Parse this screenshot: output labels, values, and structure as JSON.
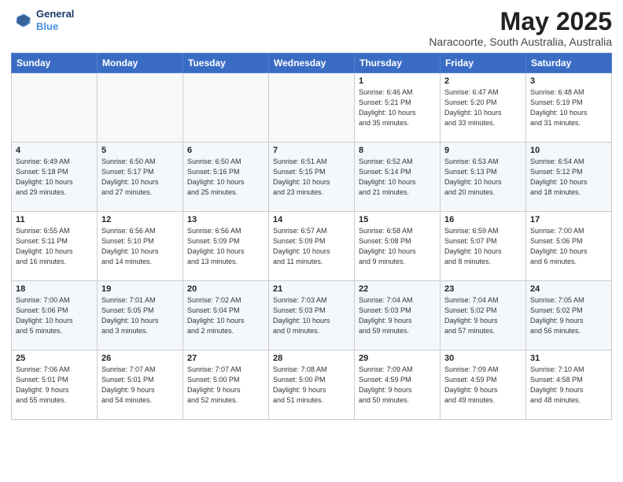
{
  "header": {
    "logo_line1": "General",
    "logo_line2": "Blue",
    "month_title": "May 2025",
    "subtitle": "Naracoorte, South Australia, Australia"
  },
  "days_of_week": [
    "Sunday",
    "Monday",
    "Tuesday",
    "Wednesday",
    "Thursday",
    "Friday",
    "Saturday"
  ],
  "weeks": [
    [
      {
        "day": "",
        "info": ""
      },
      {
        "day": "",
        "info": ""
      },
      {
        "day": "",
        "info": ""
      },
      {
        "day": "",
        "info": ""
      },
      {
        "day": "1",
        "info": "Sunrise: 6:46 AM\nSunset: 5:21 PM\nDaylight: 10 hours\nand 35 minutes."
      },
      {
        "day": "2",
        "info": "Sunrise: 6:47 AM\nSunset: 5:20 PM\nDaylight: 10 hours\nand 33 minutes."
      },
      {
        "day": "3",
        "info": "Sunrise: 6:48 AM\nSunset: 5:19 PM\nDaylight: 10 hours\nand 31 minutes."
      }
    ],
    [
      {
        "day": "4",
        "info": "Sunrise: 6:49 AM\nSunset: 5:18 PM\nDaylight: 10 hours\nand 29 minutes."
      },
      {
        "day": "5",
        "info": "Sunrise: 6:50 AM\nSunset: 5:17 PM\nDaylight: 10 hours\nand 27 minutes."
      },
      {
        "day": "6",
        "info": "Sunrise: 6:50 AM\nSunset: 5:16 PM\nDaylight: 10 hours\nand 25 minutes."
      },
      {
        "day": "7",
        "info": "Sunrise: 6:51 AM\nSunset: 5:15 PM\nDaylight: 10 hours\nand 23 minutes."
      },
      {
        "day": "8",
        "info": "Sunrise: 6:52 AM\nSunset: 5:14 PM\nDaylight: 10 hours\nand 21 minutes."
      },
      {
        "day": "9",
        "info": "Sunrise: 6:53 AM\nSunset: 5:13 PM\nDaylight: 10 hours\nand 20 minutes."
      },
      {
        "day": "10",
        "info": "Sunrise: 6:54 AM\nSunset: 5:12 PM\nDaylight: 10 hours\nand 18 minutes."
      }
    ],
    [
      {
        "day": "11",
        "info": "Sunrise: 6:55 AM\nSunset: 5:11 PM\nDaylight: 10 hours\nand 16 minutes."
      },
      {
        "day": "12",
        "info": "Sunrise: 6:56 AM\nSunset: 5:10 PM\nDaylight: 10 hours\nand 14 minutes."
      },
      {
        "day": "13",
        "info": "Sunrise: 6:56 AM\nSunset: 5:09 PM\nDaylight: 10 hours\nand 13 minutes."
      },
      {
        "day": "14",
        "info": "Sunrise: 6:57 AM\nSunset: 5:09 PM\nDaylight: 10 hours\nand 11 minutes."
      },
      {
        "day": "15",
        "info": "Sunrise: 6:58 AM\nSunset: 5:08 PM\nDaylight: 10 hours\nand 9 minutes."
      },
      {
        "day": "16",
        "info": "Sunrise: 6:59 AM\nSunset: 5:07 PM\nDaylight: 10 hours\nand 8 minutes."
      },
      {
        "day": "17",
        "info": "Sunrise: 7:00 AM\nSunset: 5:06 PM\nDaylight: 10 hours\nand 6 minutes."
      }
    ],
    [
      {
        "day": "18",
        "info": "Sunrise: 7:00 AM\nSunset: 5:06 PM\nDaylight: 10 hours\nand 5 minutes."
      },
      {
        "day": "19",
        "info": "Sunrise: 7:01 AM\nSunset: 5:05 PM\nDaylight: 10 hours\nand 3 minutes."
      },
      {
        "day": "20",
        "info": "Sunrise: 7:02 AM\nSunset: 5:04 PM\nDaylight: 10 hours\nand 2 minutes."
      },
      {
        "day": "21",
        "info": "Sunrise: 7:03 AM\nSunset: 5:03 PM\nDaylight: 10 hours\nand 0 minutes."
      },
      {
        "day": "22",
        "info": "Sunrise: 7:04 AM\nSunset: 5:03 PM\nDaylight: 9 hours\nand 59 minutes."
      },
      {
        "day": "23",
        "info": "Sunrise: 7:04 AM\nSunset: 5:02 PM\nDaylight: 9 hours\nand 57 minutes."
      },
      {
        "day": "24",
        "info": "Sunrise: 7:05 AM\nSunset: 5:02 PM\nDaylight: 9 hours\nand 56 minutes."
      }
    ],
    [
      {
        "day": "25",
        "info": "Sunrise: 7:06 AM\nSunset: 5:01 PM\nDaylight: 9 hours\nand 55 minutes."
      },
      {
        "day": "26",
        "info": "Sunrise: 7:07 AM\nSunset: 5:01 PM\nDaylight: 9 hours\nand 54 minutes."
      },
      {
        "day": "27",
        "info": "Sunrise: 7:07 AM\nSunset: 5:00 PM\nDaylight: 9 hours\nand 52 minutes."
      },
      {
        "day": "28",
        "info": "Sunrise: 7:08 AM\nSunset: 5:00 PM\nDaylight: 9 hours\nand 51 minutes."
      },
      {
        "day": "29",
        "info": "Sunrise: 7:09 AM\nSunset: 4:59 PM\nDaylight: 9 hours\nand 50 minutes."
      },
      {
        "day": "30",
        "info": "Sunrise: 7:09 AM\nSunset: 4:59 PM\nDaylight: 9 hours\nand 49 minutes."
      },
      {
        "day": "31",
        "info": "Sunrise: 7:10 AM\nSunset: 4:58 PM\nDaylight: 9 hours\nand 48 minutes."
      }
    ]
  ]
}
